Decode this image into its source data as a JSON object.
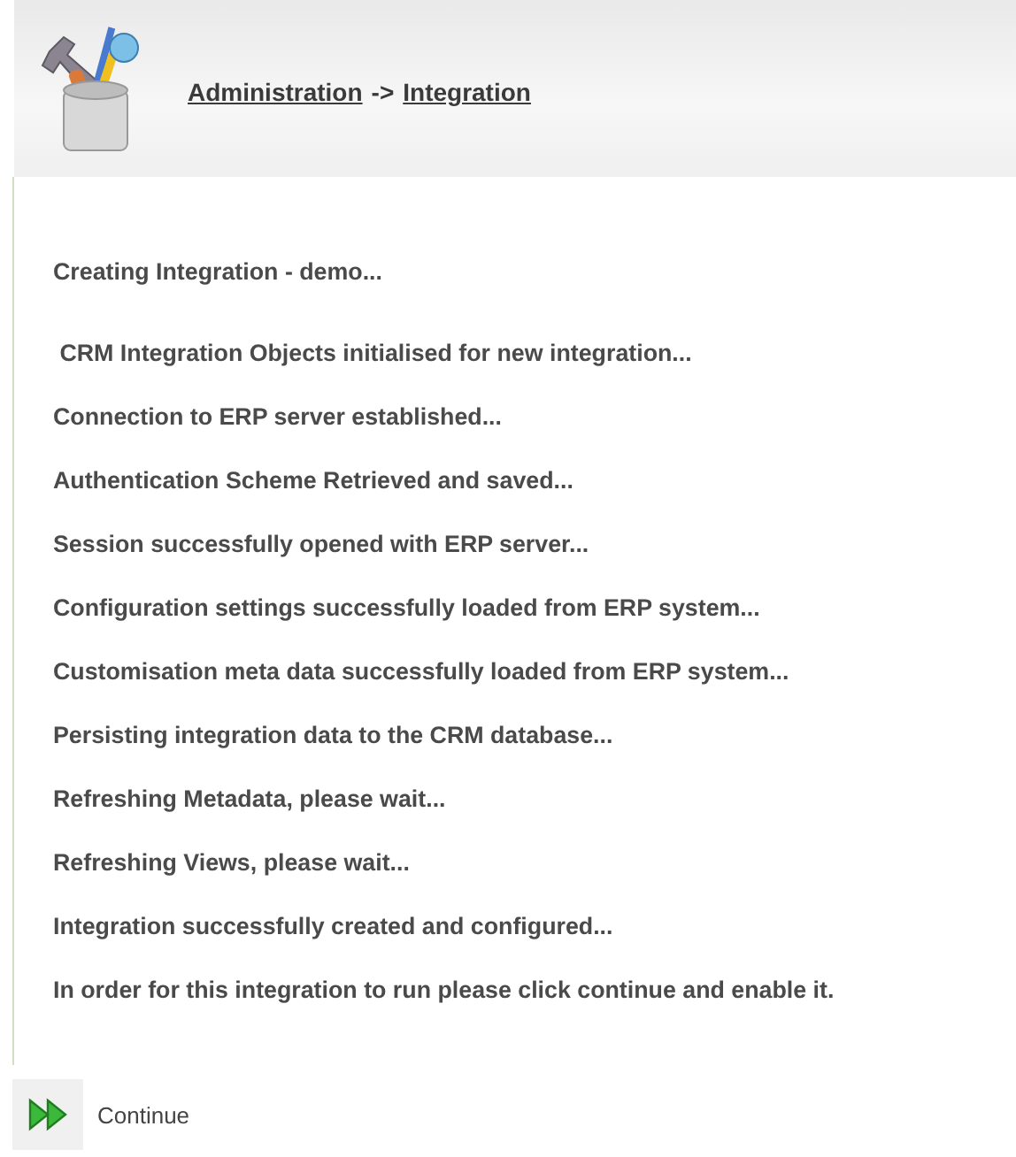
{
  "breadcrumb": [
    {
      "label": "Administration",
      "link": true
    },
    {
      "label": "->",
      "link": false
    },
    {
      "label": "Integration",
      "link": true
    }
  ],
  "heading": "Creating Integration - demo...",
  "messages": [
    " CRM Integration Objects initialised for new integration...",
    "Connection to ERP server established...",
    "Authentication Scheme Retrieved and saved...",
    "Session successfully opened with ERP server...",
    "Configuration settings successfully loaded from ERP system...",
    "Customisation meta data successfully loaded from ERP system...",
    "Persisting integration data to the CRM database...",
    "Refreshing Metadata, please wait...",
    "Refreshing Views, please wait...",
    "Integration successfully created and configured...",
    "In order for this integration to run please click continue and enable it."
  ],
  "button": {
    "label": "Continue"
  }
}
